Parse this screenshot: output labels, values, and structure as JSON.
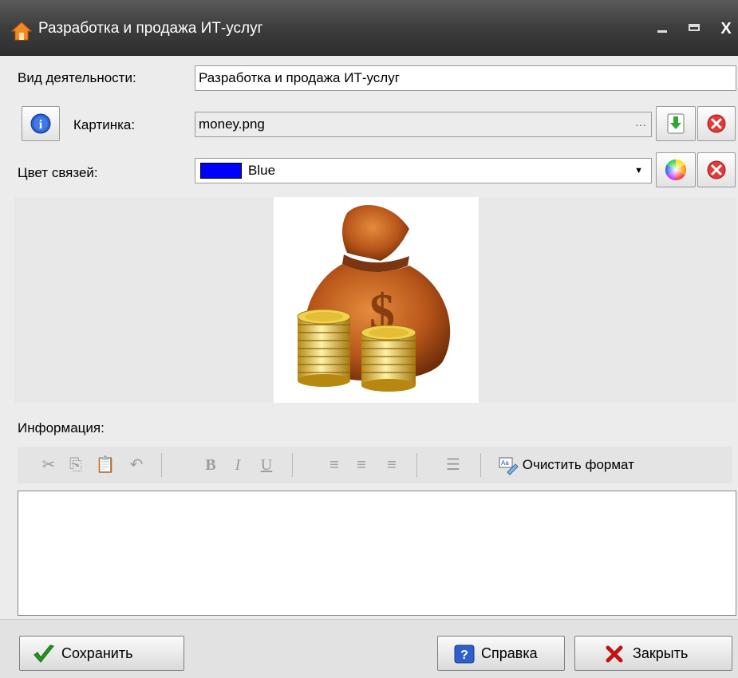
{
  "window": {
    "title": "Разработка и продажа ИТ-услуг",
    "icon": "house-icon",
    "controls": [
      "minimize-icon",
      "maximize-icon",
      "close-icon"
    ]
  },
  "form": {
    "activity_label": "Вид деятельности:",
    "activity_value": "Разработка и продажа ИТ-услуг",
    "picture_label": "Картинка:",
    "picture_value": "money.png",
    "picture_ellipsis": "···",
    "color_label": "Цвет связей:",
    "color_value": "Blue",
    "color_swatch": "#0000ff"
  },
  "image": {
    "name": "money-bag-image"
  },
  "info": {
    "label": "Информация:",
    "clear_format_label": "Очистить формат",
    "toolbar_icons": [
      "cut-icon",
      "copy-icon",
      "paste-icon",
      "undo-icon",
      "bold-icon",
      "italic-icon",
      "underline-icon",
      "align-left-icon",
      "align-center-icon",
      "align-right-icon",
      "bullet-list-icon",
      "clear-format-icon"
    ],
    "content": ""
  },
  "buttons": {
    "save": "Сохранить",
    "help": "Справка",
    "close": "Закрыть"
  }
}
